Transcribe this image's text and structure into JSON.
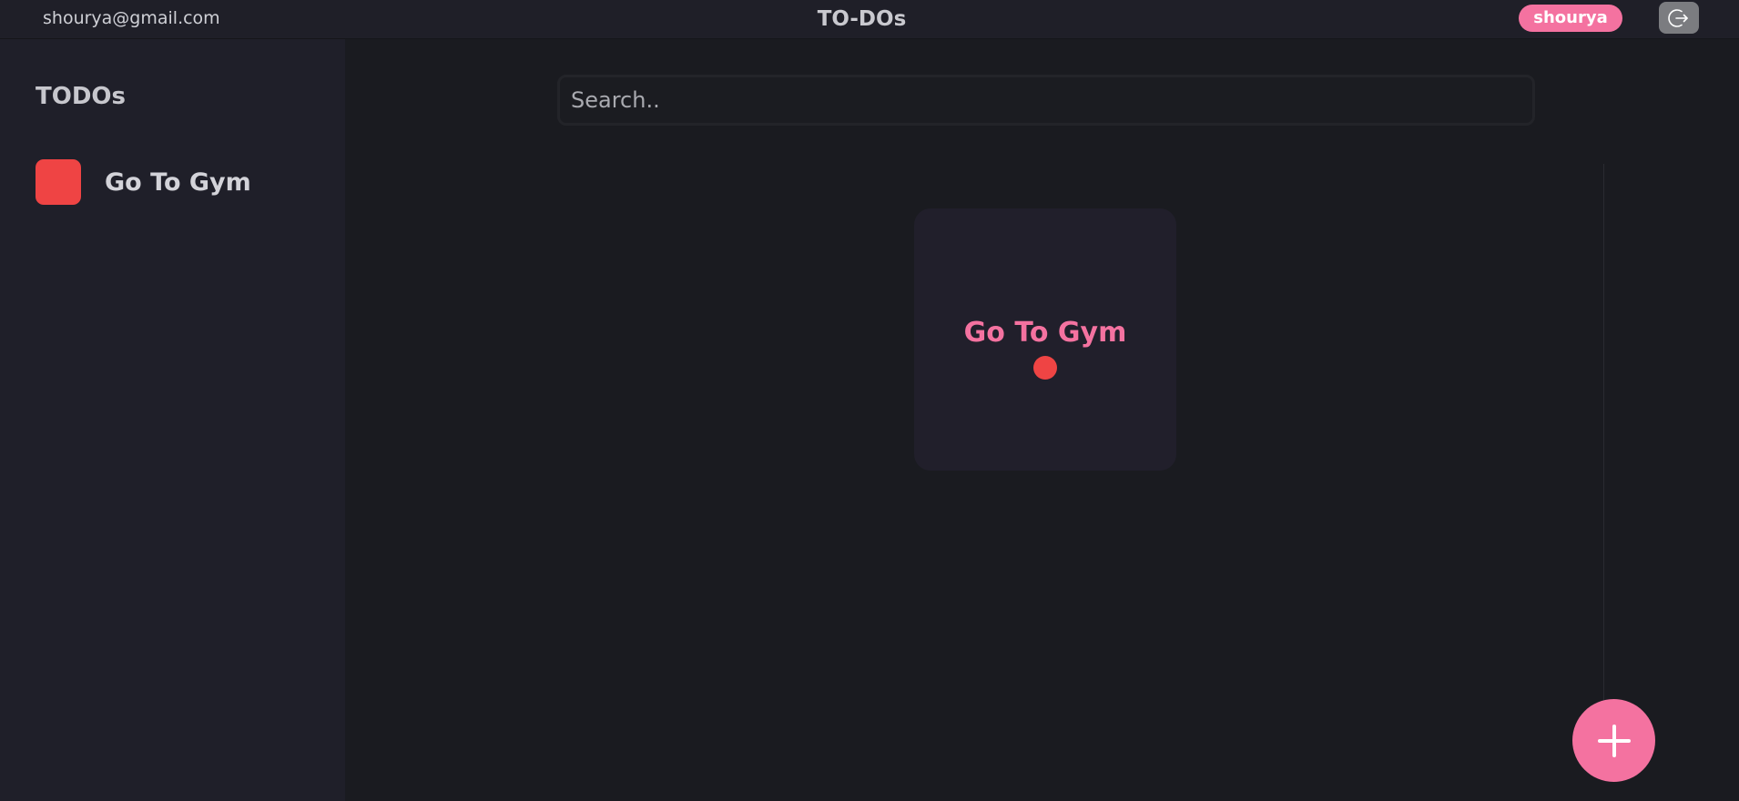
{
  "header": {
    "email": "shourya@gmail.com",
    "title": "TO-DOs",
    "username": "shourya",
    "logout_icon": "logout-icon"
  },
  "sidebar": {
    "title": "TODOs",
    "items": [
      {
        "label": "Go To Gym",
        "color": "#ef4444"
      }
    ]
  },
  "search": {
    "placeholder": "Search..",
    "value": ""
  },
  "cards": [
    {
      "title": "Go To Gym",
      "color": "#ef4444"
    }
  ],
  "fab": {
    "icon": "plus-icon"
  },
  "colors": {
    "accent": "#f472a0",
    "todo_red": "#ef4444",
    "background": "#1a1b20",
    "sidebar": "#1f1f29"
  }
}
